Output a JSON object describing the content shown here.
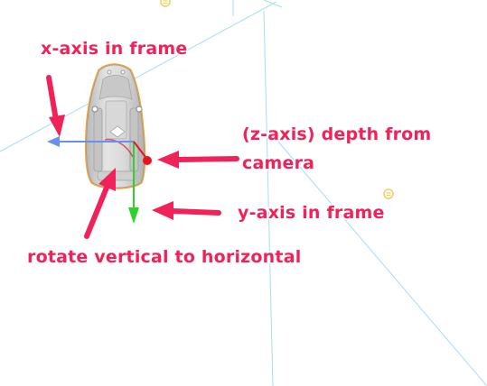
{
  "colors": {
    "annotation": "#f0225a",
    "annotation_outline": "#ffffff",
    "background": "#ffffff",
    "wireframe": "#a8dcef",
    "x_axis": "#6a8ff0",
    "y_axis": "#2fd12f",
    "z_axis": "#e8141e",
    "selection_outline": "#f2a533",
    "object_fill": "#d2d2d2",
    "light_marker": "#ecd25a"
  },
  "annotations": {
    "x_axis_label": "x-axis in frame",
    "z_axis_label_line1": "(z-axis) depth from",
    "z_axis_label_line2": "camera",
    "y_axis_label": "y-axis in frame",
    "rotate_label": "rotate vertical to horizontal"
  },
  "icons": {
    "light_marker": "light-icon"
  }
}
